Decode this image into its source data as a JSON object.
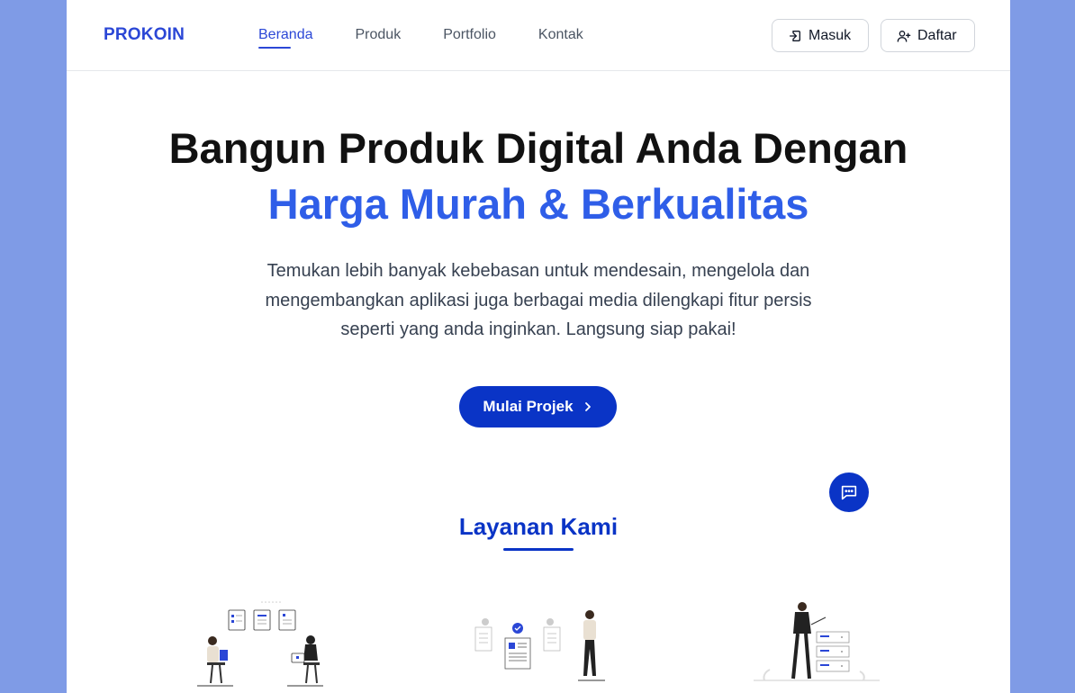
{
  "brand": {
    "logo": "PROKOIN"
  },
  "nav": {
    "links": [
      "Beranda",
      "Produk",
      "Portfolio",
      "Kontak"
    ],
    "active_index": 0
  },
  "auth": {
    "login_label": "Masuk",
    "register_label": "Daftar"
  },
  "hero": {
    "title": "Bangun Produk Digital Anda Dengan",
    "highlight": "Harga Murah & Berkualitas",
    "description": "Temukan lebih banyak kebebasan untuk mendesain, mengelola dan mengembangkan aplikasi juga berbagai media dilengkapi fitur persis seperti yang anda inginkan. Langsung siap pakai!",
    "cta_label": "Mulai Projek"
  },
  "services": {
    "title": "Layanan Kami"
  },
  "icons": {
    "login": "login-icon",
    "register": "user-plus-icon",
    "cta": "chevron-right-icon",
    "chat": "chat-bubble-icon"
  },
  "colors": {
    "brand": "#2b47d6",
    "primary": "#0a34c6",
    "highlight": "#2f5ee8",
    "backdrop": "#7f9be6"
  }
}
